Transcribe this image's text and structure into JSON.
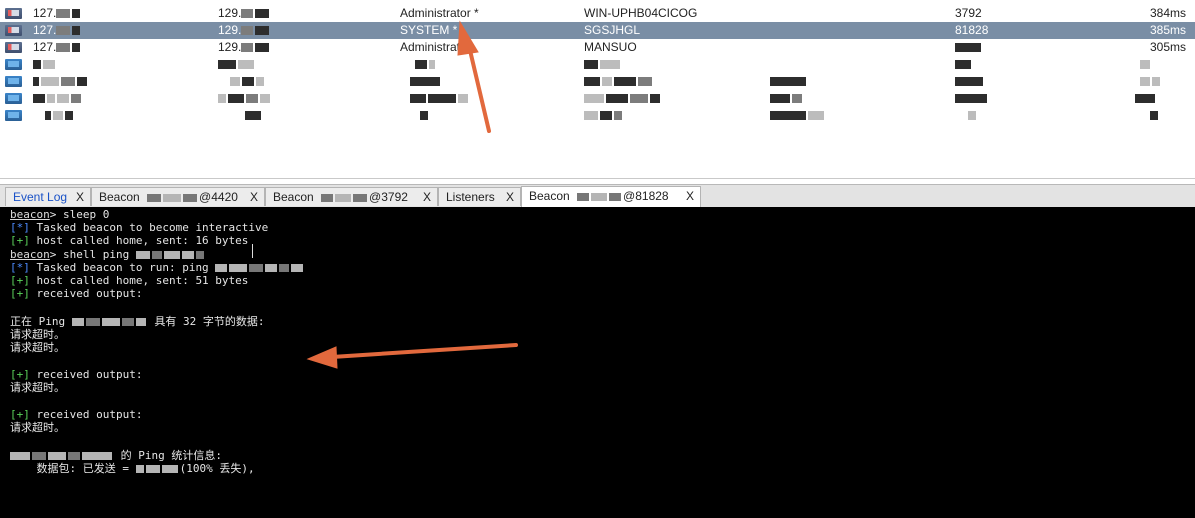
{
  "beacons": [
    {
      "ip": "127.",
      "external": "129.",
      "user": "Administrator *",
      "computer": "WIN-UPHB04CICOG",
      "pid": "3792",
      "last": "384ms",
      "selected": false,
      "icon": "monitor-icon"
    },
    {
      "ip": "127.",
      "external": "129.",
      "user": "SYSTEM *",
      "computer": "SGSJHGL",
      "pid": "81828",
      "last": "385ms",
      "selected": true,
      "icon": "monitor-icon"
    },
    {
      "ip": "127.",
      "external": "129.",
      "user": "Administrat",
      "computer": "MANSUO",
      "pid": "",
      "last": "305ms",
      "selected": false,
      "icon": "monitor-icon"
    }
  ],
  "tabs": [
    {
      "label": "Event Log",
      "close": "X"
    },
    {
      "label": "Beacon",
      "suffix": "@4420",
      "close": "X"
    },
    {
      "label": "Beacon",
      "suffix": "@3792",
      "close": "X"
    },
    {
      "label": "Listeners",
      "close": "X"
    },
    {
      "label": "Beacon",
      "suffix": "@81828",
      "close": "X"
    }
  ],
  "console": {
    "prompt": "beacon",
    "cmd1": "> sleep 0",
    "info_tag": "[*]",
    "ok_tag": "[+]",
    "l_tasked_interactive": " Tasked beacon to become interactive",
    "l_sent16": " host called home, sent: 16 bytes",
    "cmd2": "> shell ping ",
    "l_tasked_run": " Tasked beacon to run: ping ",
    "l_sent51": " host called home, sent: 51 bytes",
    "l_received": " received output:",
    "ping_prefix": "正在 Ping ",
    "ping_suffix": " 具有 32 字节的数据:",
    "timeout": "请求超时。",
    "stats_suffix": " 的 Ping 统计信息:",
    "packets_prefix": "    数据包: 已发送 = ",
    "packets_suffix": "(100% 丢失),"
  },
  "colors": {
    "selected_row": "#7a8ea5",
    "console_bg": "#000000",
    "info_tag": "#4d8cff",
    "ok_tag": "#5bd35b",
    "arrow": "#e2693d"
  }
}
